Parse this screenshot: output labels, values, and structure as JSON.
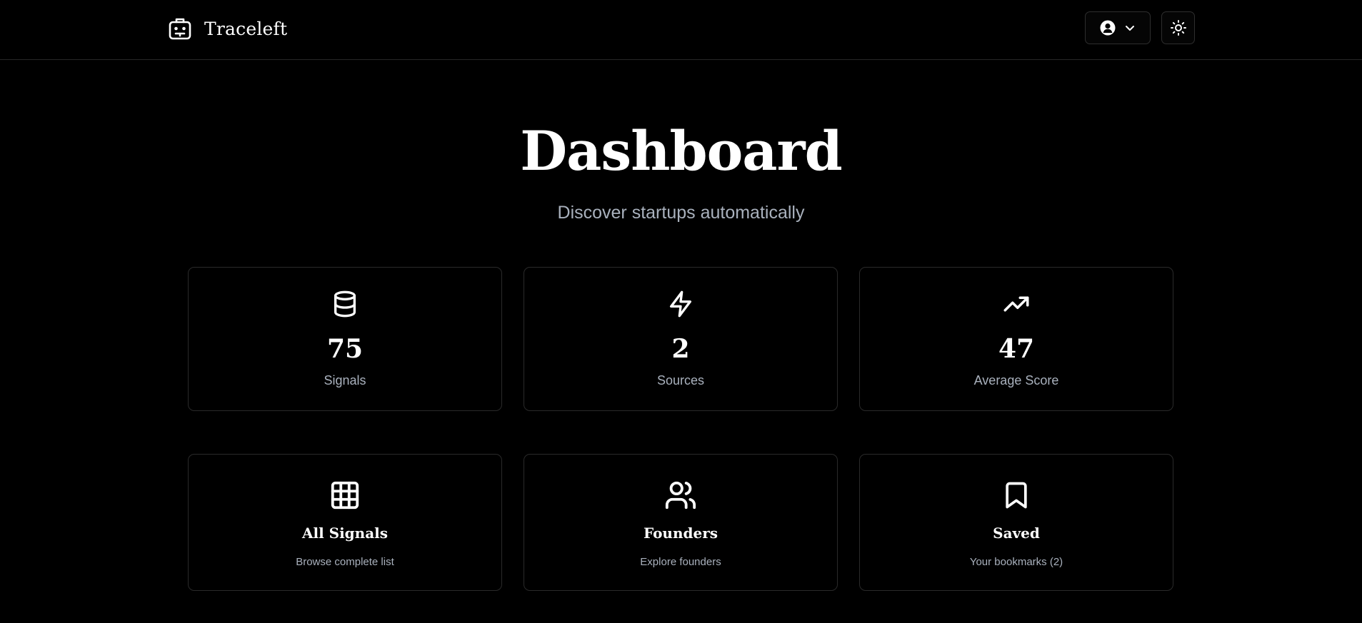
{
  "header": {
    "brand_name": "Traceleft",
    "brand_icon": "robot-icon",
    "user_menu_icon": "user-icon",
    "user_menu_chevron": "chevron-down-icon",
    "theme_toggle_icon": "sun-icon"
  },
  "hero": {
    "title": "Dashboard",
    "subtitle": "Discover startups automatically"
  },
  "stats": [
    {
      "icon": "database-icon",
      "value": "75",
      "label": "Signals"
    },
    {
      "icon": "zap-icon",
      "value": "2",
      "label": "Sources"
    },
    {
      "icon": "trending-up-icon",
      "value": "47",
      "label": "Average Score"
    }
  ],
  "nav_cards": [
    {
      "icon": "grid-icon",
      "title": "All Signals",
      "description": "Browse complete list"
    },
    {
      "icon": "users-icon",
      "title": "Founders",
      "description": "Explore founders"
    },
    {
      "icon": "bookmark-icon",
      "title": "Saved",
      "description": "Your bookmarks (2)"
    }
  ],
  "colors": {
    "background": "#000000",
    "text": "#ffffff",
    "muted_text": "#a9b1bd",
    "border": "#2a2a2a"
  }
}
